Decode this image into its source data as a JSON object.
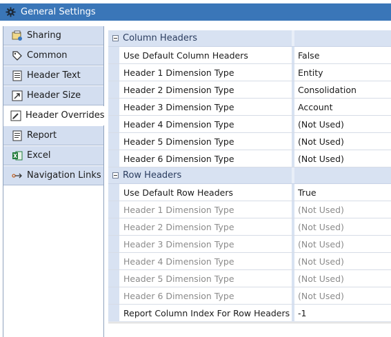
{
  "window": {
    "title": "General Settings",
    "icon": "gear-icon",
    "accent": "#3a76b8"
  },
  "sidebar": {
    "items": [
      {
        "label": "Sharing",
        "icon": "sharing-icon",
        "active": false
      },
      {
        "label": "Common",
        "icon": "tag-icon",
        "active": false
      },
      {
        "label": "Header Text",
        "icon": "document-icon",
        "active": false
      },
      {
        "label": "Header Size",
        "icon": "resize-icon",
        "active": false
      },
      {
        "label": "Header Overrides",
        "icon": "edit-icon",
        "active": true
      },
      {
        "label": "Report",
        "icon": "report-icon",
        "active": false
      },
      {
        "label": "Excel",
        "icon": "excel-icon",
        "active": false
      },
      {
        "label": "Navigation Links",
        "icon": "link-icon",
        "active": false
      }
    ]
  },
  "grid": {
    "categories": [
      {
        "label": "Column Headers",
        "rows": [
          {
            "name": "Use Default Column Headers",
            "value": "False",
            "disabled": false
          },
          {
            "name": "Header 1 Dimension Type",
            "value": "Entity",
            "disabled": false
          },
          {
            "name": "Header 2 Dimension Type",
            "value": "Consolidation",
            "disabled": false
          },
          {
            "name": "Header 3 Dimension Type",
            "value": "Account",
            "disabled": false
          },
          {
            "name": "Header 4 Dimension Type",
            "value": "(Not Used)",
            "disabled": false
          },
          {
            "name": "Header 5 Dimension Type",
            "value": "(Not Used)",
            "disabled": false
          },
          {
            "name": "Header 6 Dimension Type",
            "value": "(Not Used)",
            "disabled": false
          }
        ]
      },
      {
        "label": "Row Headers",
        "rows": [
          {
            "name": "Use Default Row Headers",
            "value": "True",
            "disabled": false
          },
          {
            "name": "Header 1 Dimension Type",
            "value": "(Not Used)",
            "disabled": true
          },
          {
            "name": "Header 2 Dimension Type",
            "value": "(Not Used)",
            "disabled": true
          },
          {
            "name": "Header 3 Dimension Type",
            "value": "(Not Used)",
            "disabled": true
          },
          {
            "name": "Header 4 Dimension Type",
            "value": "(Not Used)",
            "disabled": true
          },
          {
            "name": "Header 5 Dimension Type",
            "value": "(Not Used)",
            "disabled": true
          },
          {
            "name": "Header 6 Dimension Type",
            "value": "(Not Used)",
            "disabled": true
          },
          {
            "name": "Report Column Index For Row Headers",
            "value": "-1",
            "disabled": false
          }
        ]
      }
    ]
  }
}
